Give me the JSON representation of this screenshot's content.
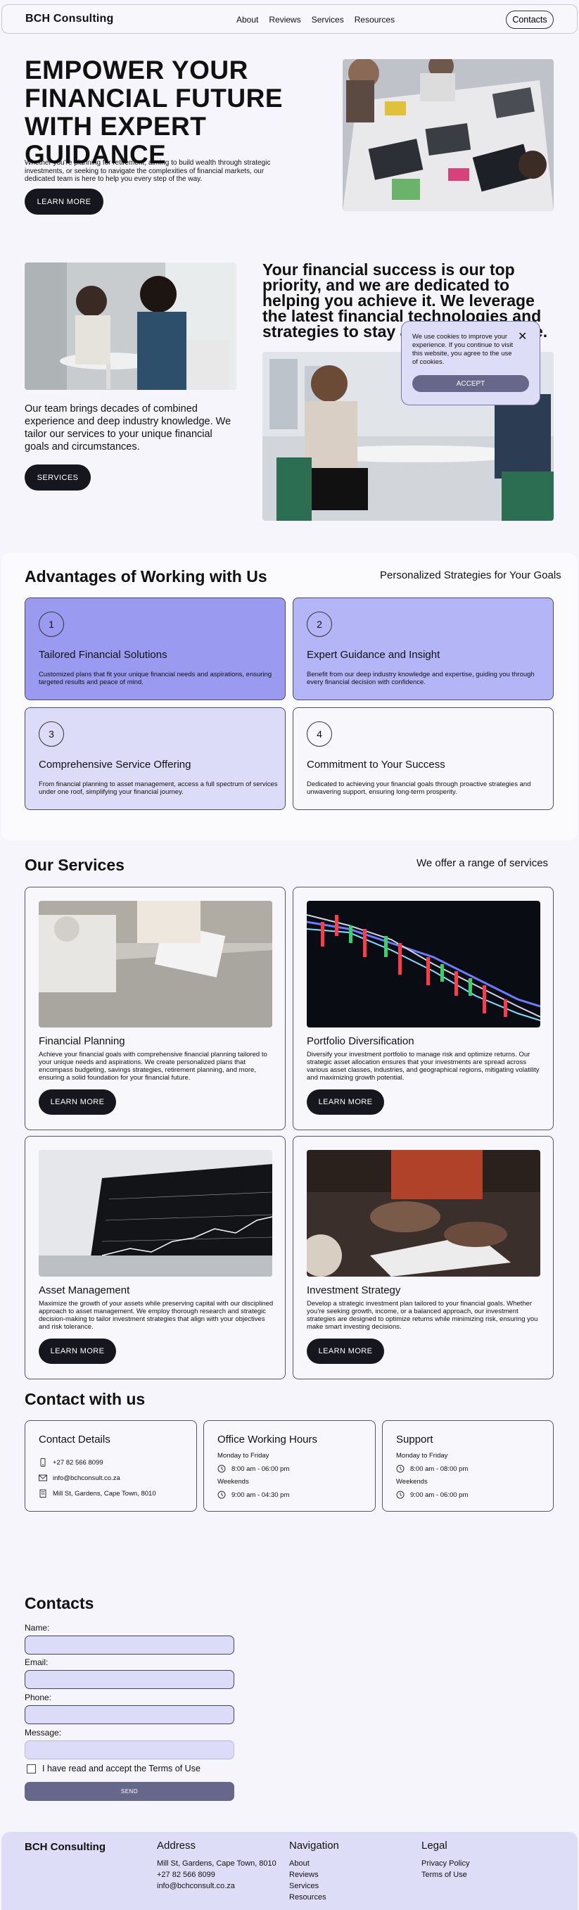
{
  "header": {
    "brand": "BCH Consulting",
    "nav": [
      "About",
      "Reviews",
      "Services",
      "Resources"
    ],
    "contacts_button": "Contacts"
  },
  "hero": {
    "title": "EMPOWER YOUR FINANCIAL FUTURE WITH EXPERT GUIDANCE",
    "subtitle": "Whether you're planning for retirement, aiming to build wealth through strategic investments, or seeking to navigate the complexities of financial markets, our dedicated team is here to help you every step of the way.",
    "button": "LEARN MORE"
  },
  "about": {
    "text": "Our team brings decades of combined experience and deep industry knowledge. We tailor our services to your unique financial goals and circumstances.",
    "button": "SERVICES",
    "statement": "Your financial success is our top priority, and we are dedicated to helping you achieve it. We leverage the latest financial technologies and strategies to stay ahead of the curve."
  },
  "cookie": {
    "text": "We use cookies to improve your experience. If you continue to visit this website, you agree to the use of cookies.",
    "close": "✕",
    "accept": "ACCEPT"
  },
  "advantages": {
    "title": "Advantages of Working with Us",
    "side": "Personalized Strategies for Your Goals",
    "items": [
      {
        "num": "1",
        "title": "Tailored Financial Solutions",
        "desc": "Customized plans that fit your unique financial needs and aspirations, ensuring targeted results and peace of mind.",
        "color": "#9a9bf0"
      },
      {
        "num": "2",
        "title": "Expert Guidance and Insight",
        "desc": "Benefit from our deep industry knowledge and expertise, guiding you through every financial decision with confidence.",
        "color": "#b4b5f6"
      },
      {
        "num": "3",
        "title": "Comprehensive Service Offering",
        "desc": "From financial planning to asset management, access a full spectrum of services under one roof, simplifying your financial journey.",
        "color": "#dcdcf8"
      },
      {
        "num": "4",
        "title": "Commitment to Your Success",
        "desc": "Dedicated to achieving your financial goals through proactive strategies and unwavering support, ensuring long-term prosperity.",
        "color": "#f7f7fc"
      }
    ]
  },
  "services": {
    "title": "Our Services",
    "side": "We offer a range of services",
    "items": [
      {
        "title": "Financial Planning",
        "desc": "Achieve your financial goals with comprehensive financial planning tailored to your unique needs and aspirations. We create personalized plans that encompass budgeting, savings strategies, retirement planning, and more, ensuring a solid foundation for your financial future.",
        "button": "LEARN MORE"
      },
      {
        "title": "Portfolio Diversification",
        "desc": "Diversify your investment portfolio to manage risk and optimize returns. Our strategic asset allocation ensures that your investments are spread across various asset classes, industries, and geographical regions, mitigating volatility and maximizing growth potential.",
        "button": "LEARN MORE"
      },
      {
        "title": "Asset Management",
        "desc": "Maximize the growth of your assets while preserving capital with our disciplined approach to asset management. We employ thorough research and strategic decision-making to tailor investment strategies that align with your objectives and risk tolerance.",
        "button": "LEARN MORE"
      },
      {
        "title": "Investment Strategy",
        "desc": "Develop a strategic investment plan tailored to your financial goals. Whether you're seeking growth, income, or a balanced approach, our investment strategies are designed to optimize returns while minimizing risk, ensuring you make smart investing decisions.",
        "button": "LEARN MORE"
      }
    ]
  },
  "contact_info": {
    "title": "Contact with us",
    "details": {
      "title": "Contact Details",
      "phone": "+27 82 566 8099",
      "email": "info@bchconsult.co.za",
      "address": "Mill St, Gardens, Cape Town, 8010"
    },
    "hours": {
      "title": "Office Working Hours",
      "weekdays_label": "Monday to Friday",
      "weekdays_time": "8:00 am - 06:00 pm",
      "weekends_label": "Weekends",
      "weekends_time": "9:00 am - 04:30 pm"
    },
    "support": {
      "title": "Support",
      "weekdays_label": "Monday to Friday",
      "weekdays_time": "8:00 am - 08:00 pm",
      "weekends_label": "Weekends",
      "weekends_time": "9:00 am - 06:00 pm"
    }
  },
  "form": {
    "title": "Contacts",
    "name_label": "Name:",
    "email_label": "Email:",
    "phone_label": "Phone:",
    "message_label": "Message:",
    "terms": "I have read and accept the Terms of Use",
    "send": "SEND"
  },
  "footer": {
    "brand": "BCH Consulting",
    "address_title": "Address",
    "address_lines": [
      "Mill St, Gardens, Cape Town, 8010",
      "+27 82 566 8099",
      "info@bchconsult.co.za"
    ],
    "nav_title": "Navigation",
    "nav_items": [
      "About",
      "Reviews",
      "Services",
      "Resources"
    ],
    "legal_title": "Legal",
    "legal_items": [
      "Privacy Policy",
      "Terms of Use"
    ]
  }
}
